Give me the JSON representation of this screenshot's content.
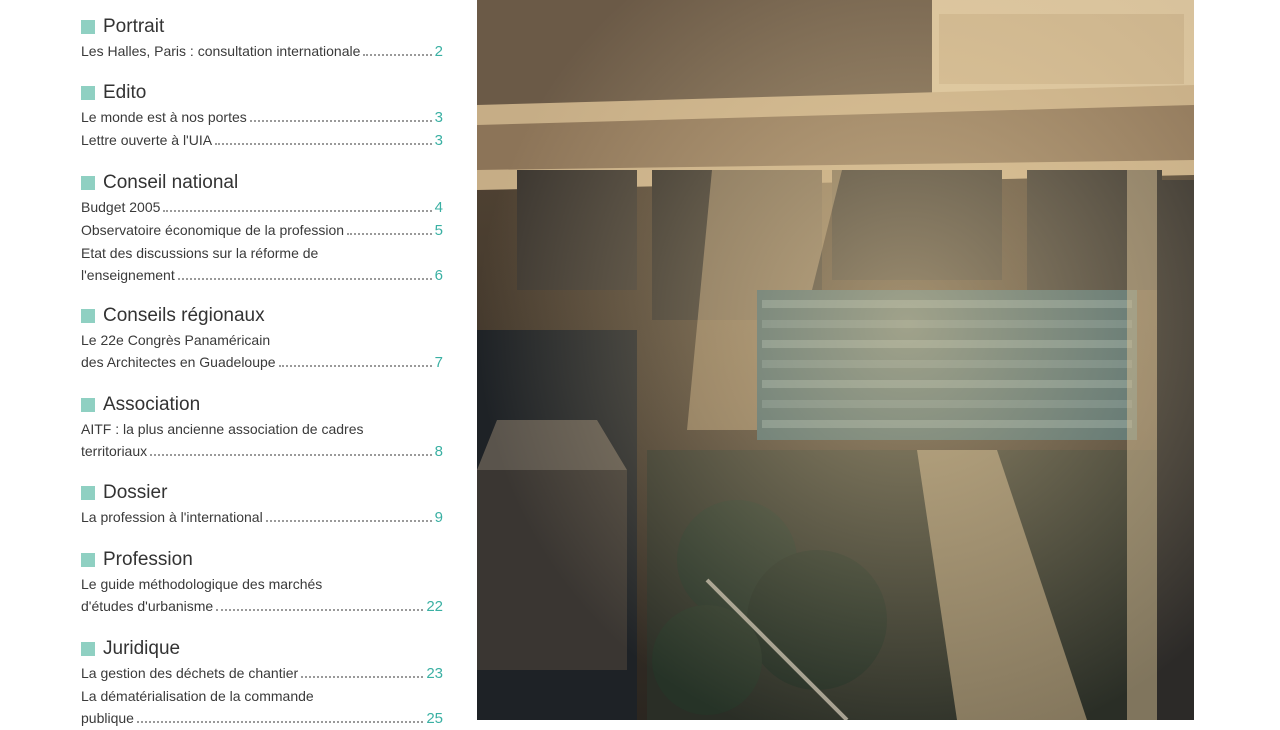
{
  "toc": {
    "sections": [
      {
        "title": "Portrait",
        "entries": [
          {
            "text": "Les Halles, Paris : consultation internationale",
            "page": "2"
          }
        ]
      },
      {
        "title": "Edito",
        "entries": [
          {
            "text": "Le monde est à nos portes",
            "page": "3"
          },
          {
            "text": "Lettre ouverte à l'UIA",
            "page": "3"
          }
        ]
      },
      {
        "title": "Conseil national",
        "entries": [
          {
            "text": "Budget 2005",
            "page": "4"
          },
          {
            "text": "Observatoire économique de la profession",
            "page": "5"
          },
          {
            "pre": "Etat des discussions sur la réforme de",
            "text": "l'enseignement",
            "page": "6"
          }
        ]
      },
      {
        "title": "Conseils régionaux",
        "entries": [
          {
            "pre": "Le 22e Congrès Panaméricain",
            "text": "des Architectes en Guadeloupe",
            "page": "7"
          }
        ]
      },
      {
        "title": "Association",
        "entries": [
          {
            "pre": "AITF : la plus ancienne association de cadres",
            "text": "territoriaux",
            "page": "8"
          }
        ]
      },
      {
        "title": "Dossier",
        "entries": [
          {
            "text": "La profession à l'international",
            "page": "9"
          }
        ]
      },
      {
        "title": "Profession",
        "entries": [
          {
            "pre": "Le guide méthodologique des marchés",
            "text": "d'études d'urbanisme",
            "page": "22"
          }
        ]
      },
      {
        "title": "Juridique",
        "entries": [
          {
            "text": "La gestion des déchets de chantier",
            "page": "23"
          },
          {
            "pre": "La dématérialisation de la commande",
            "text": "publique",
            "page": "25"
          }
        ]
      }
    ]
  },
  "colors": {
    "accent": "#8fd0c2",
    "page_number": "#3ab0a3"
  },
  "photo": {
    "subject": "aerial-night-view-les-halles-paris"
  }
}
